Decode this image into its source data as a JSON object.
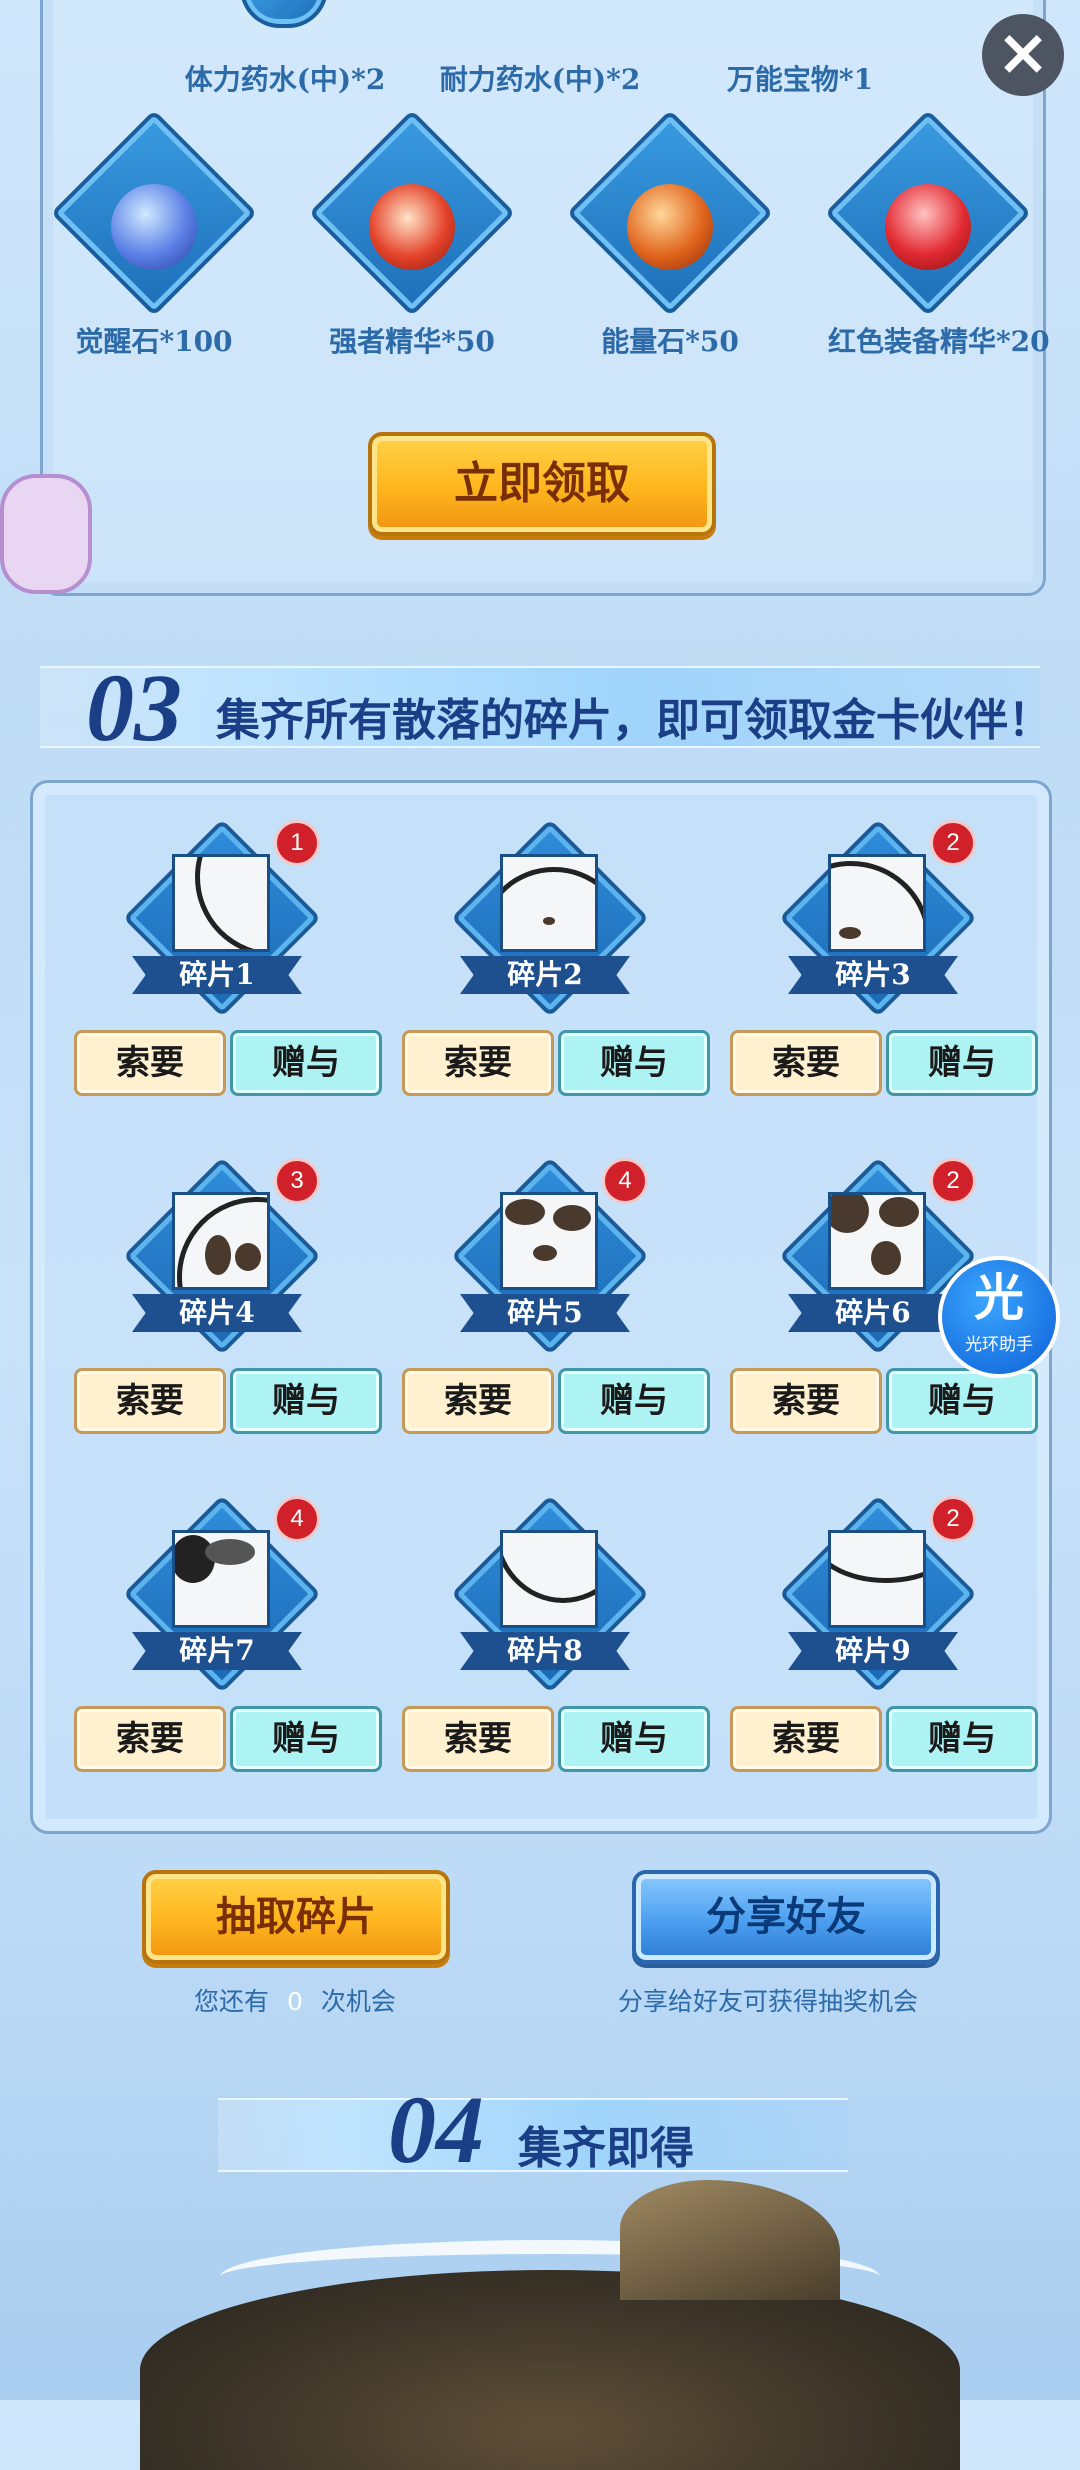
{
  "close_button": {
    "icon": "close-icon"
  },
  "rewards_top": [
    {
      "label": "体力药水(中)*2"
    },
    {
      "label": "耐力药水(中)*2"
    },
    {
      "label": "万能宝物*1"
    }
  ],
  "rewards": [
    {
      "label": "觉醒石*100",
      "icon": "crystal-icon",
      "color": "#5a7fe6"
    },
    {
      "label": "强者精华*50",
      "icon": "red-gem-icon",
      "color": "#e4432a"
    },
    {
      "label": "能量石*50",
      "icon": "orange-orb-icon",
      "color": "#e0641c"
    },
    {
      "label": "红色装备精华*20",
      "icon": "red-crystal-icon",
      "color": "#e22a32"
    }
  ],
  "claim_button": {
    "label": "立即领取"
  },
  "section3": {
    "number": "03",
    "title": "集齐所有散落的碎片，即可领取金卡伙伴！"
  },
  "fragments": [
    {
      "name": "碎片1",
      "count": "1",
      "ask": "索要",
      "give": "赠与"
    },
    {
      "name": "碎片2",
      "count": "",
      "ask": "索要",
      "give": "赠与"
    },
    {
      "name": "碎片3",
      "count": "2",
      "ask": "索要",
      "give": "赠与"
    },
    {
      "name": "碎片4",
      "count": "3",
      "ask": "索要",
      "give": "赠与"
    },
    {
      "name": "碎片5",
      "count": "4",
      "ask": "索要",
      "give": "赠与"
    },
    {
      "name": "碎片6",
      "count": "2",
      "ask": "索要",
      "give": "赠与"
    },
    {
      "name": "碎片7",
      "count": "4",
      "ask": "索要",
      "give": "赠与"
    },
    {
      "name": "碎片8",
      "count": "",
      "ask": "索要",
      "give": "赠与"
    },
    {
      "name": "碎片9",
      "count": "2",
      "ask": "索要",
      "give": "赠与"
    }
  ],
  "draw": {
    "button": "抽取碎片",
    "hint_prefix": "您还有",
    "chances": "0",
    "hint_suffix": "次机会"
  },
  "share": {
    "button": "分享好友",
    "hint": "分享给好友可获得抽奖机会"
  },
  "section4": {
    "number": "04",
    "title": "集齐即得"
  },
  "helper": {
    "glyph": "光",
    "label": "光环助手"
  }
}
